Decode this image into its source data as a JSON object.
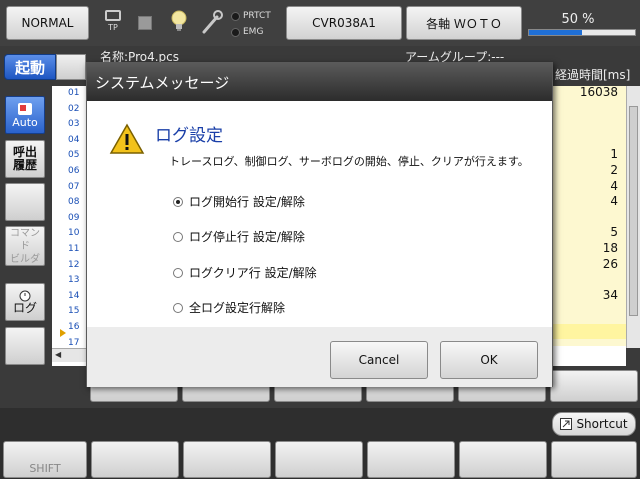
{
  "topbar": {
    "mode_label": "NORMAL",
    "tp_label": "TP",
    "prtct_label": "PRTCT",
    "emg_label": "EMG",
    "controller_label": "CVR038A1",
    "axis_label": "各軸 ＷＯＴＯ",
    "progress_text": "50 %",
    "progress_fraction": 0.5,
    "progress_color": "#1f6fd6"
  },
  "row2": {
    "start_label": "起動",
    "filename": "名称:Pro4.pcs",
    "armgroup": "アームグループ:---",
    "elapsed_header": "経過時間[ms]"
  },
  "sidebar": {
    "auto_label": "Auto",
    "recall_label_1": "呼出",
    "recall_label_2": "履歴",
    "command_label_1": "コマンド",
    "command_label_2": "ビルダ",
    "log_label": "ログ"
  },
  "list": {
    "line_numbers": [
      "01",
      "02",
      "03",
      "04",
      "05",
      "06",
      "07",
      "08",
      "09",
      "10",
      "11",
      "12",
      "13",
      "14",
      "15",
      "16",
      "17"
    ],
    "elapsed_values": [
      "16038",
      "",
      "",
      "",
      "1",
      "2",
      "4",
      "4",
      "",
      "5",
      "18",
      "26",
      "",
      "34",
      "",
      "",
      ""
    ]
  },
  "fkeys": {
    "shift_label": "SHIFT",
    "shortcut_label": "Shortcut"
  },
  "dialog": {
    "title": "システムメッセージ",
    "heading": "ログ設定",
    "description": "トレースログ、制御ログ、サーボログの開始、停止、クリアが行えます。",
    "options": [
      {
        "label": "ログ開始行  設定/解除",
        "checked": true
      },
      {
        "label": "ログ停止行  設定/解除",
        "checked": false
      },
      {
        "label": "ログクリア行  設定/解除",
        "checked": false
      },
      {
        "label": "全ログ設定行解除",
        "checked": false
      }
    ],
    "cancel_label": "Cancel",
    "ok_label": "OK"
  }
}
